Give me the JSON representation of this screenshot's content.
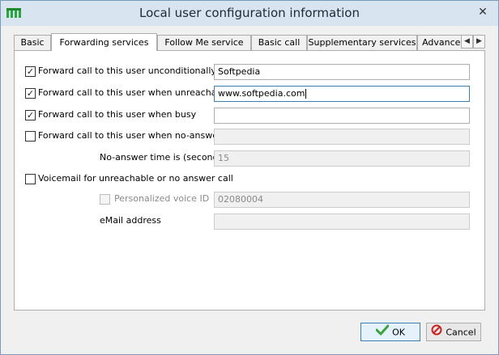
{
  "window": {
    "title": "Local user configuration information",
    "close_glyph": "✕",
    "app_icon": "app-logo-icon"
  },
  "tabs": [
    {
      "label": "Basic",
      "active": false
    },
    {
      "label": "Forwarding services",
      "active": true
    },
    {
      "label": "Follow Me service",
      "active": false
    },
    {
      "label": "Basic call",
      "active": false
    },
    {
      "label": "Supplementary services",
      "active": false
    },
    {
      "label": "Advance ser",
      "active": false
    }
  ],
  "tab_scroll": {
    "left": "◀",
    "right": "▶"
  },
  "form": {
    "unconditional": {
      "label": "Forward call to this user unconditionally",
      "checked": true,
      "value": "Softpedia"
    },
    "unreachable": {
      "label": "Forward call to this user when unreachable",
      "checked": true,
      "value": "www.softpedia.com"
    },
    "busy": {
      "label": "Forward call to this user when busy",
      "checked": true,
      "value": ""
    },
    "no_answer": {
      "label": "Forward call to this user when no-answer",
      "checked": false,
      "value": ""
    },
    "no_answer_time": {
      "label": "No-answer time is (seconds)",
      "value": "15"
    },
    "voicemail": {
      "label": "Voicemail for unreachable or no answer call",
      "checked": false
    },
    "voice_id": {
      "label": "Personalized voice ID",
      "checked": false,
      "value": "02080004"
    },
    "email": {
      "label": "eMail address",
      "value": ""
    }
  },
  "buttons": {
    "ok": "OK",
    "cancel": "Cancel"
  },
  "colors": {
    "ok_check": "#3aa33a",
    "cancel_ring": "#cc2222",
    "app_logo": "#27a83a"
  }
}
